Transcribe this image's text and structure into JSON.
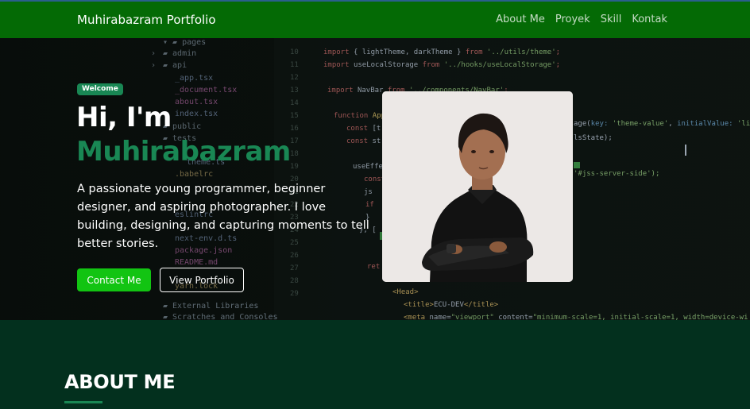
{
  "navbar": {
    "brand": "Muhirabazram Portfolio",
    "links": [
      "About Me",
      "Proyek",
      "Skill",
      "Kontak"
    ]
  },
  "hero": {
    "badge": "Welcome",
    "greeting": "Hi, I'm",
    "name": "Muhirabazram",
    "description": "A passionate young programmer, beginner designer, and aspiring photographer. I love building, designing, and capturing moments to tell better stories.",
    "contact_button": "Contact Me",
    "portfolio_button": "View Portfolio"
  },
  "about": {
    "title": "ABOUT ME"
  },
  "colors": {
    "navbar": "#046a05",
    "accent": "#198754",
    "contact_button": "#12c412",
    "about_bg": "#03301e"
  }
}
